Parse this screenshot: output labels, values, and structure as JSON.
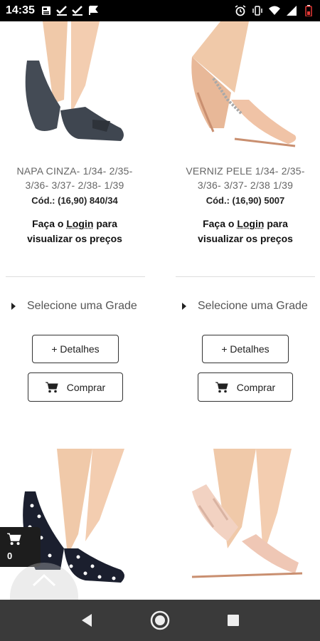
{
  "status_bar": {
    "time": "14:35",
    "left_icons": [
      "news-icon",
      "check-icon",
      "check-icon",
      "flag-icon"
    ],
    "right_icons": [
      "alarm-icon",
      "vibrate-icon",
      "wifi-icon",
      "signal-icon",
      "battery-icon"
    ]
  },
  "products": [
    {
      "name_lines": [
        "NAPA CINZA- 1/34- 2/35-",
        "3/36- 3/37- 2/38- 1/39"
      ],
      "code": "Cód.: (16,90) 840/34",
      "login_line1_pre": "Faça o ",
      "login_link": "Login",
      "login_line1_post": " para",
      "login_line2": "visualizar os preços",
      "grade": "Selecione uma Grade",
      "details": "+ Detalhes",
      "buy": "Comprar"
    },
    {
      "name_lines": [
        "VERNIZ PELE 1/34- 2/35-",
        "3/36- 3/37- 2/38 1/39"
      ],
      "code": "Cód.: (16,90) 5007",
      "login_line1_pre": "Faça o ",
      "login_link": "Login",
      "login_line1_post": " para",
      "login_line2": "visualizar os preços",
      "grade": "Selecione uma Grade",
      "details": "+ Detalhes",
      "buy": "Comprar"
    }
  ],
  "cart": {
    "count": "0"
  },
  "colors": {
    "status_bar": "#000000",
    "nav_bar": "#3a3a3a",
    "cart": "#1d1d1d"
  }
}
